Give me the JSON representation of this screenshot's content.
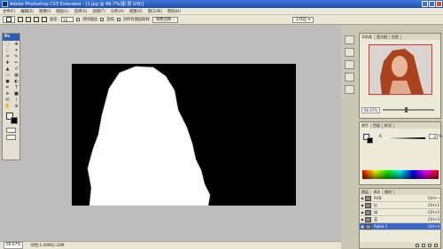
{
  "titlebar": {
    "title": "Adobe Photoshop CS3 Extended - [1.jpg @ 66.7%(图 层 0/8)]"
  },
  "menus": [
    "文件(F)",
    "编辑(E)",
    "图像(I)",
    "图层(L)",
    "选择(S)",
    "滤镜(T)",
    "分析(A)",
    "视图(V)",
    "窗口(W)",
    "帮助(H)"
  ],
  "options": {
    "tolerance_label": "容差:",
    "tolerance_value": "10",
    "antialias_label": "消除锯齿",
    "contiguous_label": "连续",
    "all_layers_label": "对所有图层取样",
    "refine_edge_label": "调整边缘...",
    "workspace_label": "工作区 ▾"
  },
  "toolbox": {
    "badge": "Ps"
  },
  "status": {
    "zoom": "66.67%",
    "doc_size": "文档:1.00M/2.33M"
  },
  "navigator": {
    "tabs": [
      "导航器",
      "直方图",
      "信息"
    ],
    "zoom": "66.67%"
  },
  "color_panel": {
    "tabs": [
      "颜色",
      "色板",
      "样式"
    ],
    "channel_label": "K",
    "value": "0",
    "unit": "%"
  },
  "channels": {
    "tabs": [
      "图层",
      "通道",
      "路径"
    ],
    "rows": [
      {
        "name": "RGB",
        "key": "Ctrl+~",
        "selected": false
      },
      {
        "name": "红",
        "key": "Ctrl+1",
        "selected": false
      },
      {
        "name": "绿",
        "key": "Ctrl+2",
        "selected": false
      },
      {
        "name": "蓝",
        "key": "Ctrl+3",
        "selected": false
      },
      {
        "name": "Alpha 1",
        "key": "Ctrl+4",
        "selected": true
      }
    ]
  },
  "colors": {
    "title_bar": "#1d4fb2",
    "canvas_black": "#000000",
    "mask_white": "#ffffff",
    "selection_accent": "#3a66c4",
    "nav_frame": "#e03030"
  }
}
